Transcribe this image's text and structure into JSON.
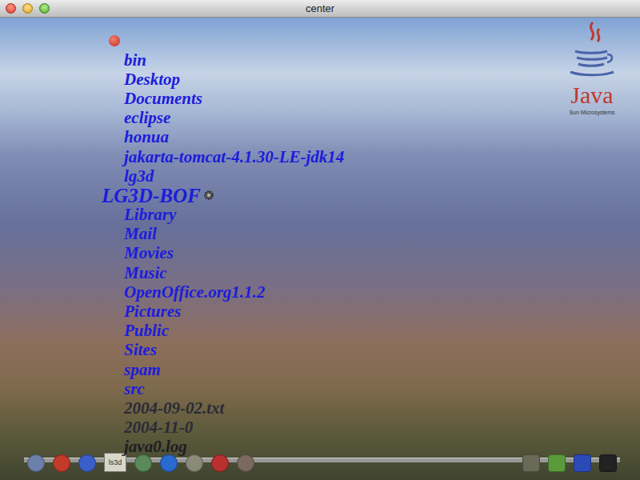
{
  "window": {
    "title": "center"
  },
  "logo": {
    "name": "Java",
    "vendor": "Sun Microsystems"
  },
  "files": [
    {
      "name": "bin",
      "selected": false,
      "color": "#1c1cdc"
    },
    {
      "name": "Desktop",
      "selected": false,
      "color": "#1c1cdc"
    },
    {
      "name": "Documents",
      "selected": false,
      "color": "#1c1cdc"
    },
    {
      "name": "eclipse",
      "selected": false,
      "color": "#1c1cdc"
    },
    {
      "name": "honua",
      "selected": false,
      "color": "#1c1cdc"
    },
    {
      "name": "jakarta-tomcat-4.1.30-LE-jdk14",
      "selected": false,
      "color": "#1c1cdc"
    },
    {
      "name": "lg3d",
      "selected": false,
      "color": "#1c1cdc"
    },
    {
      "name": "LG3D-BOF",
      "selected": true,
      "color": "#1c1cdc"
    },
    {
      "name": "Library",
      "selected": false,
      "color": "#1c1cdc"
    },
    {
      "name": "Mail",
      "selected": false,
      "color": "#1c1cdc"
    },
    {
      "name": "Movies",
      "selected": false,
      "color": "#1c1cdc"
    },
    {
      "name": "Music",
      "selected": false,
      "color": "#1c1cdc"
    },
    {
      "name": "OpenOffice.org1.1.2",
      "selected": false,
      "color": "#1c1cdc"
    },
    {
      "name": "Pictures",
      "selected": false,
      "color": "#1c1cdc"
    },
    {
      "name": "Public",
      "selected": false,
      "color": "#1c1cdc"
    },
    {
      "name": "Sites",
      "selected": false,
      "color": "#1c1cdc"
    },
    {
      "name": "spam",
      "selected": false,
      "color": "#1c1cdc"
    },
    {
      "name": "src",
      "selected": false,
      "color": "#1c1cdc"
    },
    {
      "name": "2004-09-02.txt",
      "selected": false,
      "color": "#2a2a38"
    },
    {
      "name": "2004-11-0",
      "selected": false,
      "color": "#2a2a38"
    },
    {
      "name": "java0.log",
      "selected": false,
      "color": "#1e1e24"
    }
  ],
  "dock": {
    "label": "ls3d"
  }
}
